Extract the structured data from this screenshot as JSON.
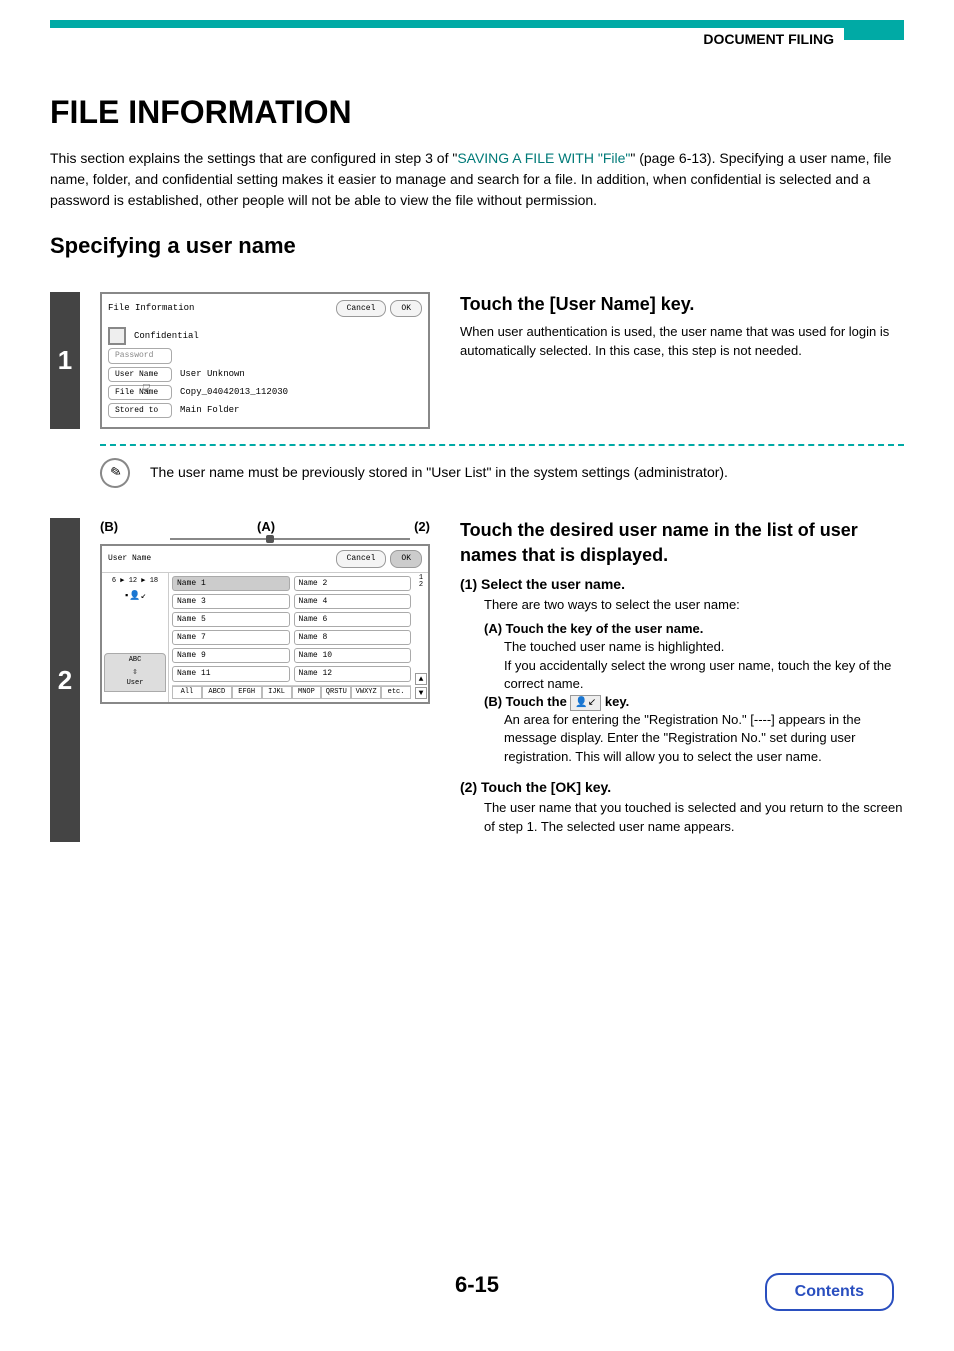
{
  "header": {
    "section": "DOCUMENT FILING"
  },
  "title": "FILE INFORMATION",
  "intro": {
    "pre": "This section explains the settings that are configured in step 3 of \"",
    "link": "SAVING A FILE WITH \"File\"",
    "post": "\" (page 6-13). Specifying a user name, file name, folder, and confidential setting makes it easier to manage and search for a file. In addition, when confidential is selected and a password is established, other people will not be able to view the file without permission."
  },
  "subheading": "Specifying a user name",
  "step1": {
    "num": "1",
    "screen": {
      "title": "File Information",
      "cancel": "Cancel",
      "ok": "OK",
      "confidential": "Confidential",
      "password": "Password",
      "user_name_btn": "User Name",
      "user_name_val": "User Unknown",
      "file_name_btn": "File Name",
      "file_name_val": "Copy_04042013_112030",
      "stored_to_btn": "Stored to",
      "stored_to_val": "Main Folder"
    },
    "heading": "Touch the [User Name] key.",
    "body": "When user authentication is used, the user name that was used for login is automatically selected. In this case, this step is not needed."
  },
  "note": "The user name must be previously stored in \"User List\" in the system settings (administrator).",
  "step2": {
    "num": "2",
    "callouts": {
      "b": "(B)",
      "a": "(A)",
      "two": "(2)"
    },
    "screen": {
      "title": "User Name",
      "cancel": "Cancel",
      "ok": "OK",
      "breadcrumb": "6 ▶ 12 ▶ 18",
      "names": [
        "Name 1",
        "Name 2",
        "Name 3",
        "Name 4",
        "Name 5",
        "Name 6",
        "Name 7",
        "Name 8",
        "Name 9",
        "Name 10",
        "Name 11",
        "Name 12"
      ],
      "page_ind": [
        "1",
        "2"
      ],
      "left_tab": "ABC",
      "left_tab2": "User",
      "bottom": [
        "All",
        "ABCD",
        "EFGH",
        "IJKL",
        "MNOP",
        "QRSTU",
        "VWXYZ",
        "etc."
      ]
    },
    "heading": "Touch the desired user name in the list of user names that is displayed.",
    "sub1": {
      "label": "(1)",
      "title": "Select the user name.",
      "lead": "There are two ways to select the user name:",
      "a_label": "(A) Touch the key of the user name.",
      "a_line1": "The touched user name is highlighted.",
      "a_line2": "If you accidentally select the wrong user name, touch the key of the correct name.",
      "b_label_pre": "(B) Touch the ",
      "b_label_post": " key.",
      "b_body": "An area for entering the \"Registration No.\" [----] appears in the message display. Enter the \"Registration No.\" set during user registration. This will allow you to select the user name."
    },
    "sub2": {
      "label": "(2)",
      "title": "Touch the [OK] key.",
      "body": "The user name that you touched is selected and you return to the screen of step 1. The selected user name appears."
    }
  },
  "page_num": "6-15",
  "contents": "Contents"
}
